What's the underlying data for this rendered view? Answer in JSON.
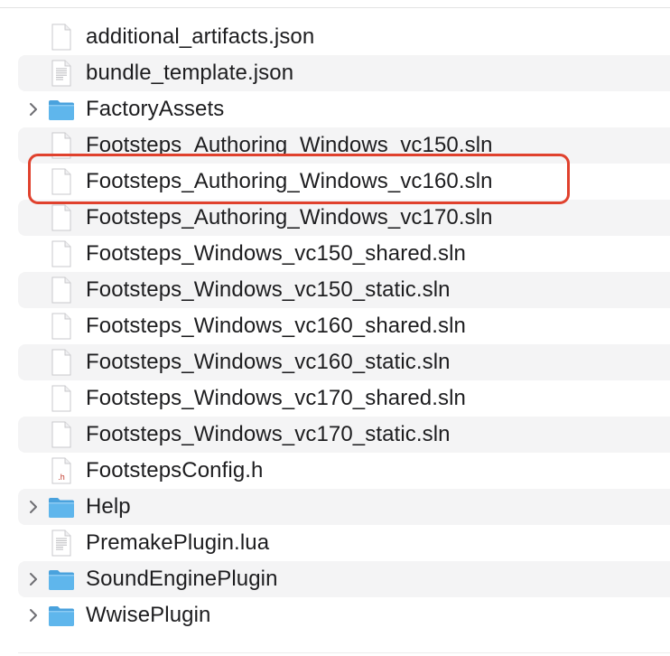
{
  "files": [
    {
      "name": "additional_artifacts.json",
      "kind": "doc",
      "expandable": false
    },
    {
      "name": "bundle_template.json",
      "kind": "doc-lines",
      "expandable": false
    },
    {
      "name": "FactoryAssets",
      "kind": "folder",
      "expandable": true
    },
    {
      "name": "Footsteps_Authoring_Windows_vc150.sln",
      "kind": "doc",
      "expandable": false
    },
    {
      "name": "Footsteps_Authoring_Windows_vc160.sln",
      "kind": "doc",
      "expandable": false,
      "highlighted": true
    },
    {
      "name": "Footsteps_Authoring_Windows_vc170.sln",
      "kind": "doc",
      "expandable": false
    },
    {
      "name": "Footsteps_Windows_vc150_shared.sln",
      "kind": "doc",
      "expandable": false
    },
    {
      "name": "Footsteps_Windows_vc150_static.sln",
      "kind": "doc",
      "expandable": false
    },
    {
      "name": "Footsteps_Windows_vc160_shared.sln",
      "kind": "doc",
      "expandable": false
    },
    {
      "name": "Footsteps_Windows_vc160_static.sln",
      "kind": "doc",
      "expandable": false
    },
    {
      "name": "Footsteps_Windows_vc170_shared.sln",
      "kind": "doc",
      "expandable": false
    },
    {
      "name": "Footsteps_Windows_vc170_static.sln",
      "kind": "doc",
      "expandable": false
    },
    {
      "name": "FootstepsConfig.h",
      "kind": "header",
      "expandable": false,
      "badge": ".h"
    },
    {
      "name": "Help",
      "kind": "folder",
      "expandable": true
    },
    {
      "name": "PremakePlugin.lua",
      "kind": "doc-lines",
      "expandable": false
    },
    {
      "name": "SoundEnginePlugin",
      "kind": "folder",
      "expandable": true
    },
    {
      "name": "WwisePlugin",
      "kind": "folder",
      "expandable": true
    }
  ],
  "colors": {
    "highlight_border": "#e0412d",
    "row_alt": "#f4f4f5",
    "folder": "#5fb6ec"
  }
}
